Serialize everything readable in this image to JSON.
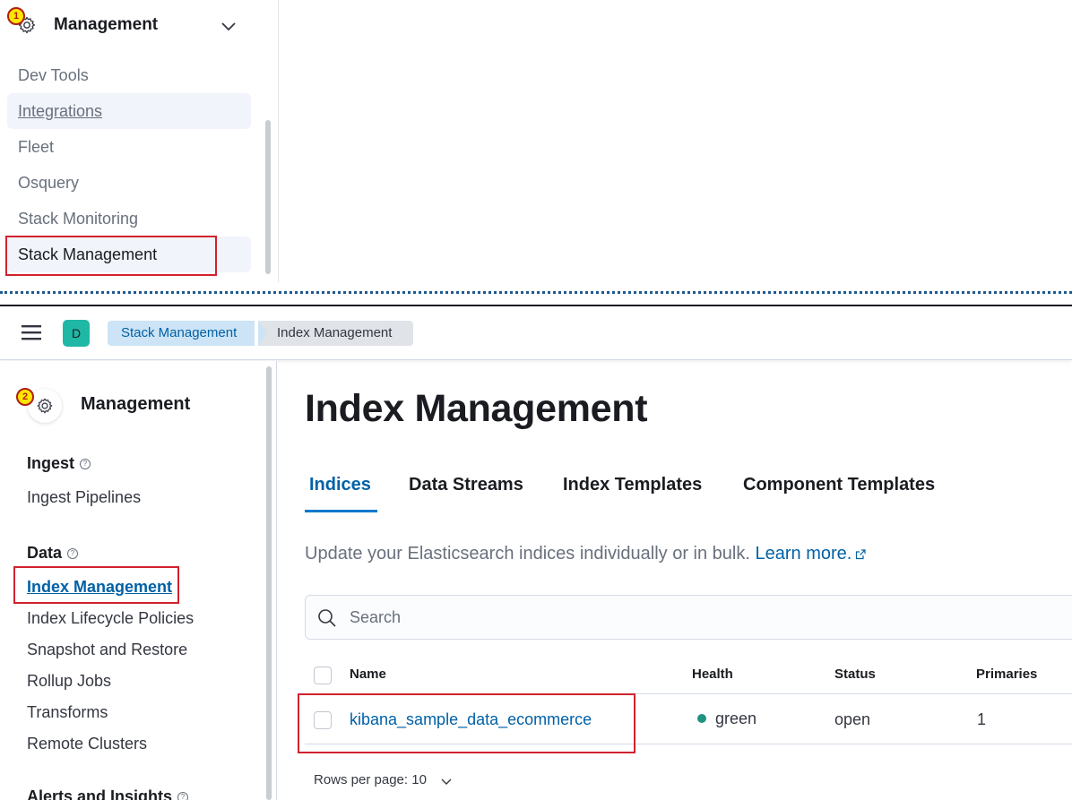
{
  "top_panel": {
    "badge": "1",
    "title": "Management",
    "items": [
      {
        "label": "Dev Tools"
      },
      {
        "label": "Integrations"
      },
      {
        "label": "Fleet"
      },
      {
        "label": "Osquery"
      },
      {
        "label": "Stack Monitoring"
      },
      {
        "label": "Stack Management"
      }
    ]
  },
  "header": {
    "avatar_initial": "D",
    "breadcrumbs": [
      "Stack Management",
      "Index Management"
    ]
  },
  "sidebar": {
    "badge": "2",
    "title": "Management",
    "sections": [
      {
        "heading": "Ingest",
        "items": [
          "Ingest Pipelines"
        ]
      },
      {
        "heading": "Data",
        "items": [
          "Index Management",
          "Index Lifecycle Policies",
          "Snapshot and Restore",
          "Rollup Jobs",
          "Transforms",
          "Remote Clusters"
        ]
      },
      {
        "heading": "Alerts and Insights",
        "items": []
      }
    ],
    "help_glyph": "?"
  },
  "main": {
    "title": "Index Management",
    "tabs": [
      "Indices",
      "Data Streams",
      "Index Templates",
      "Component Templates"
    ],
    "description": "Update your Elasticsearch indices individually or in bulk.",
    "learn_more": "Learn more.",
    "search_placeholder": "Search",
    "table": {
      "columns": [
        "Name",
        "Health",
        "Status",
        "Primaries"
      ],
      "rows": [
        {
          "name": "kibana_sample_data_ecommerce",
          "health": "green",
          "status": "open",
          "primaries": "1"
        }
      ]
    },
    "rows_per_page": "Rows per page: 10"
  },
  "colors": {
    "accent": "#0061a6",
    "highlight_box": "#d0222e",
    "health_green": "#209280",
    "avatar": "#1fb7a5"
  }
}
